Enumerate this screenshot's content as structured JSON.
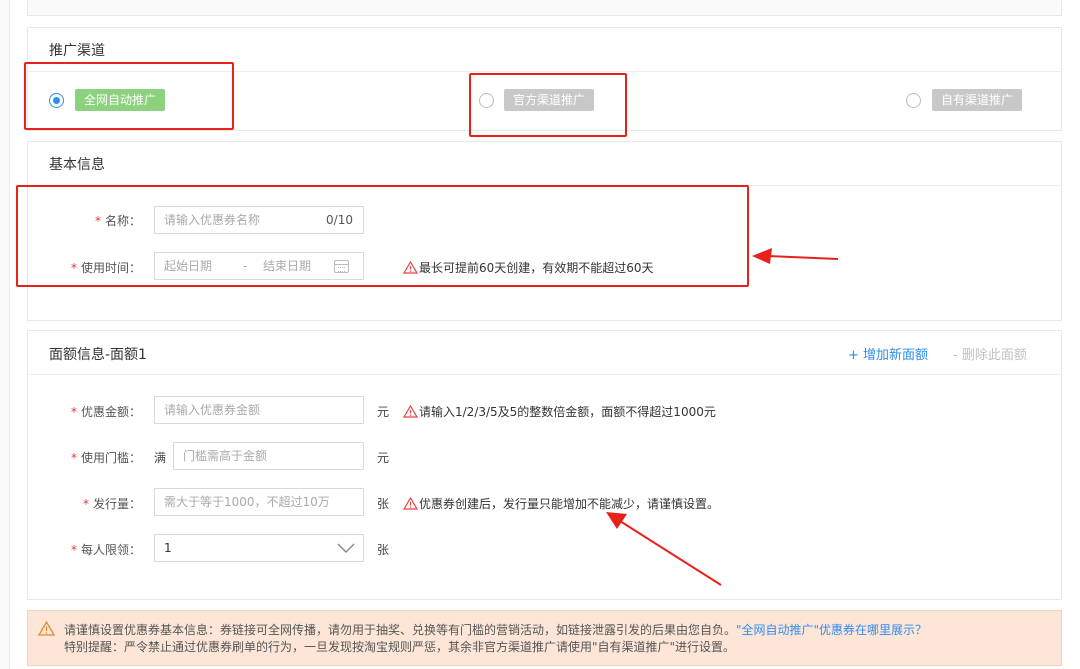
{
  "channel": {
    "title": "推广渠道",
    "options": [
      {
        "label": "全网自动推广",
        "checked": true
      },
      {
        "label": "官方渠道推广",
        "checked": false
      },
      {
        "label": "自有渠道推广",
        "checked": false
      }
    ]
  },
  "basic": {
    "title": "基本信息",
    "name_label": "名称：",
    "name_placeholder": "请输入优惠券名称",
    "name_counter": "0/10",
    "time_label": "使用时间：",
    "start_placeholder": "起始日期",
    "date_sep": "-",
    "end_placeholder": "结束日期",
    "time_hint": "最长可提前60天创建，有效期不能超过60天"
  },
  "denom": {
    "title": "面额信息-面额1",
    "add_label": "+ 增加新面额",
    "delete_label": "- 删除此面额",
    "amount_label": "优惠金额：",
    "amount_placeholder": "请输入优惠券金额",
    "amount_unit": "元",
    "amount_hint": "请输入1/2/3/5及5的整数倍金额，面额不得超过1000元",
    "threshold_label": "使用门槛：",
    "threshold_prefix": "满",
    "threshold_placeholder": "门槛需高于金额",
    "threshold_unit": "元",
    "qty_label": "发行量：",
    "qty_placeholder": "需大于等于1000，不超过10万",
    "qty_unit": "张",
    "qty_hint": "优惠券创建后，发行量只能增加不能减少，请谨慎设置。",
    "limit_label": "每人限领：",
    "limit_value": "1",
    "limit_unit": "张"
  },
  "notice": {
    "line1": "请谨慎设置优惠券基本信息：券链接可全网传播，请勿用于抽奖、兑换等有门槛的营销活动，如链接泄露引发的后果由您自负。",
    "line1_link": "\"全网自动推广\"优惠券在哪里展示？",
    "line2": "特别提醒：严令禁止通过优惠券刷单的行为，一旦发现按淘宝规则严惩，其余非官方渠道推广请使用\"自有渠道推广\"进行设置。"
  },
  "colors": {
    "accent": "#2f8cf0",
    "required": "#e4393c",
    "annotation": "#e8221b",
    "tag_active": "#8cd17d",
    "tag_inactive": "#c8c8c8",
    "notice_bg": "#fde6d8"
  }
}
